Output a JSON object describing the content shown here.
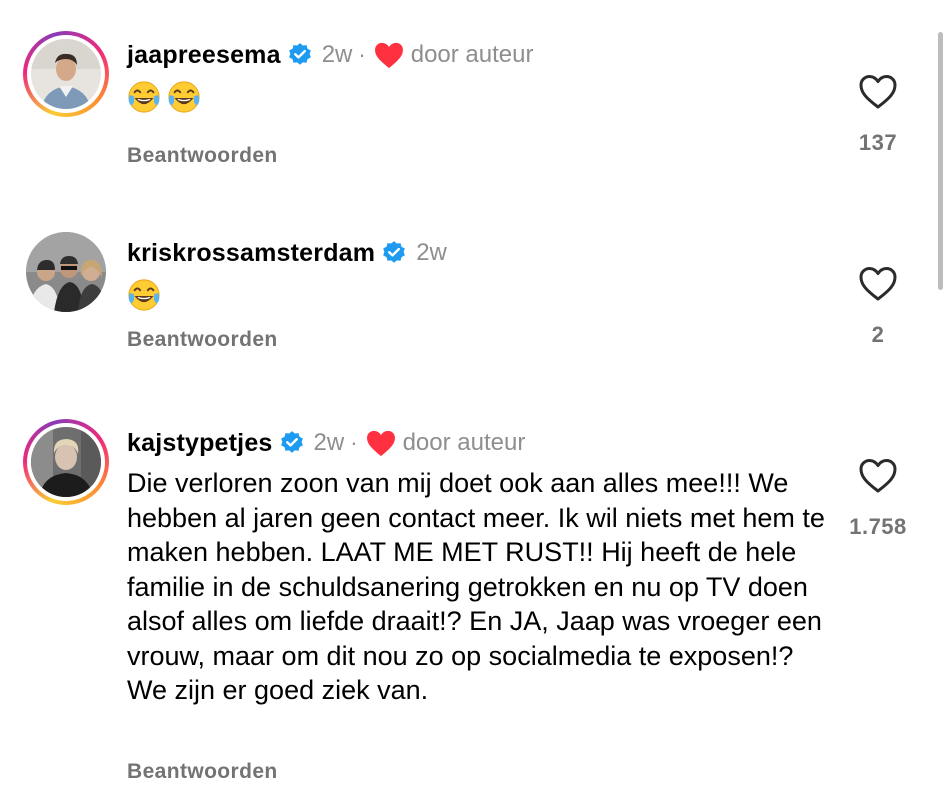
{
  "comments": [
    {
      "username": "jaapreesema",
      "time": "2w",
      "separator": "·",
      "liked_by_author": true,
      "by_author_label": "door auteur",
      "emoji": [
        "😂",
        "😂"
      ],
      "text": "",
      "reply_label": "Beantwoorden",
      "like_count": "137",
      "ring": true
    },
    {
      "username": "kriskrossamsterdam",
      "time": "2w",
      "separator": "",
      "liked_by_author": false,
      "by_author_label": "",
      "emoji": [
        "😂"
      ],
      "text": "",
      "reply_label": "Beantwoorden",
      "like_count": "2",
      "ring": false
    },
    {
      "username": "kajstypetjes",
      "time": "2w",
      "separator": "·",
      "liked_by_author": true,
      "by_author_label": "door auteur",
      "emoji": [],
      "text": "Die verloren zoon van mij doet ook aan alles mee!!! We hebben al jaren geen contact meer. Ik wil niets met hem te maken hebben. LAAT ME MET RUST!! Hij heeft de hele familie in de schuldsanering getrokken en nu op TV doen alsof alles om liefde draait!? En JA, Jaap was vroeger een vrouw, maar om dit nou zo op socialmedia te exposen!? We zijn er goed ziek van.",
      "reply_label": "Beantwoorden",
      "like_count": "1.758",
      "ring": true
    }
  ],
  "colors": {
    "verified": "#1d9bf0",
    "heart_red": "#ff3040",
    "muted": "#8e8e8e"
  },
  "icons": {
    "verified": "verified-badge-icon",
    "author_like": "heart-filled-icon",
    "like": "heart-outline-icon",
    "emoji": "face-with-tears-of-joy"
  }
}
